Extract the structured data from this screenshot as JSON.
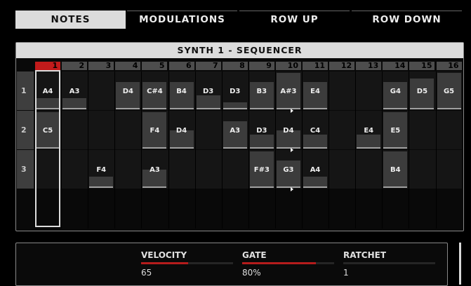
{
  "tabs": [
    {
      "label": "NOTES",
      "active": true
    },
    {
      "label": "MODULATIONS",
      "active": false
    },
    {
      "label": "ROW UP",
      "active": false
    },
    {
      "label": "ROW DOWN",
      "active": false
    }
  ],
  "sequencer": {
    "title": "SYNTH 1 - SEQUENCER",
    "columns": [
      "1",
      "2",
      "3",
      "4",
      "5",
      "6",
      "7",
      "8",
      "9",
      "10",
      "11",
      "12",
      "13",
      "14",
      "15",
      "16"
    ],
    "active_step": 1,
    "rows": [
      {
        "label": "1",
        "steps": [
          {
            "col": 1,
            "note": "A4",
            "level": 0.3,
            "tie": false
          },
          {
            "col": 2,
            "note": "A3",
            "level": 0.3,
            "tie": false
          },
          {
            "col": 4,
            "note": "D4",
            "level": 0.75,
            "tie": false
          },
          {
            "col": 5,
            "note": "C#4",
            "level": 0.75,
            "tie": false
          },
          {
            "col": 6,
            "note": "B4",
            "level": 0.75,
            "tie": false
          },
          {
            "col": 7,
            "note": "D3",
            "level": 0.38,
            "tie": false
          },
          {
            "col": 8,
            "note": "D3",
            "level": 0.2,
            "tie": false
          },
          {
            "col": 9,
            "note": "B3",
            "level": 0.75,
            "tie": false
          },
          {
            "col": 10,
            "note": "A#3",
            "level": 1.0,
            "tie": true
          },
          {
            "col": 11,
            "note": "E4",
            "level": 0.75,
            "tie": false
          },
          {
            "col": 14,
            "note": "G4",
            "level": 0.75,
            "tie": false
          },
          {
            "col": 15,
            "note": "D5",
            "level": 0.85,
            "tie": false
          },
          {
            "col": 16,
            "note": "G5",
            "level": 1.0,
            "tie": false
          }
        ]
      },
      {
        "label": "2",
        "steps": [
          {
            "col": 1,
            "note": "C5",
            "level": 1.0,
            "tie": false
          },
          {
            "col": 5,
            "note": "F4",
            "level": 1.0,
            "tie": false
          },
          {
            "col": 6,
            "note": "D4",
            "level": 0.5,
            "tie": false
          },
          {
            "col": 8,
            "note": "A3",
            "level": 0.75,
            "tie": false
          },
          {
            "col": 9,
            "note": "D3",
            "level": 0.38,
            "tie": false
          },
          {
            "col": 10,
            "note": "D4",
            "level": 0.5,
            "tie": true
          },
          {
            "col": 11,
            "note": "C4",
            "level": 0.38,
            "tie": false
          },
          {
            "col": 13,
            "note": "E4",
            "level": 0.38,
            "tie": false
          },
          {
            "col": 14,
            "note": "E5",
            "level": 1.0,
            "tie": false
          }
        ]
      },
      {
        "label": "3",
        "steps": [
          {
            "col": 3,
            "note": "F4",
            "level": 0.3,
            "tie": false
          },
          {
            "col": 5,
            "note": "A3",
            "level": 0.5,
            "tie": false
          },
          {
            "col": 9,
            "note": "F#3",
            "level": 1.0,
            "tie": false
          },
          {
            "col": 10,
            "note": "G3",
            "level": 0.75,
            "tie": true
          },
          {
            "col": 11,
            "note": "A4",
            "level": 0.3,
            "tie": false
          },
          {
            "col": 14,
            "note": "B4",
            "level": 1.0,
            "tie": false
          }
        ]
      }
    ]
  },
  "params": {
    "velocity": {
      "label": "VELOCITY",
      "value": "65",
      "level": 0.51
    },
    "gate": {
      "label": "GATE",
      "value": "80%",
      "level": 0.8
    },
    "ratchet": {
      "label": "RATCHET",
      "value": "1",
      "level": 0.0
    }
  }
}
